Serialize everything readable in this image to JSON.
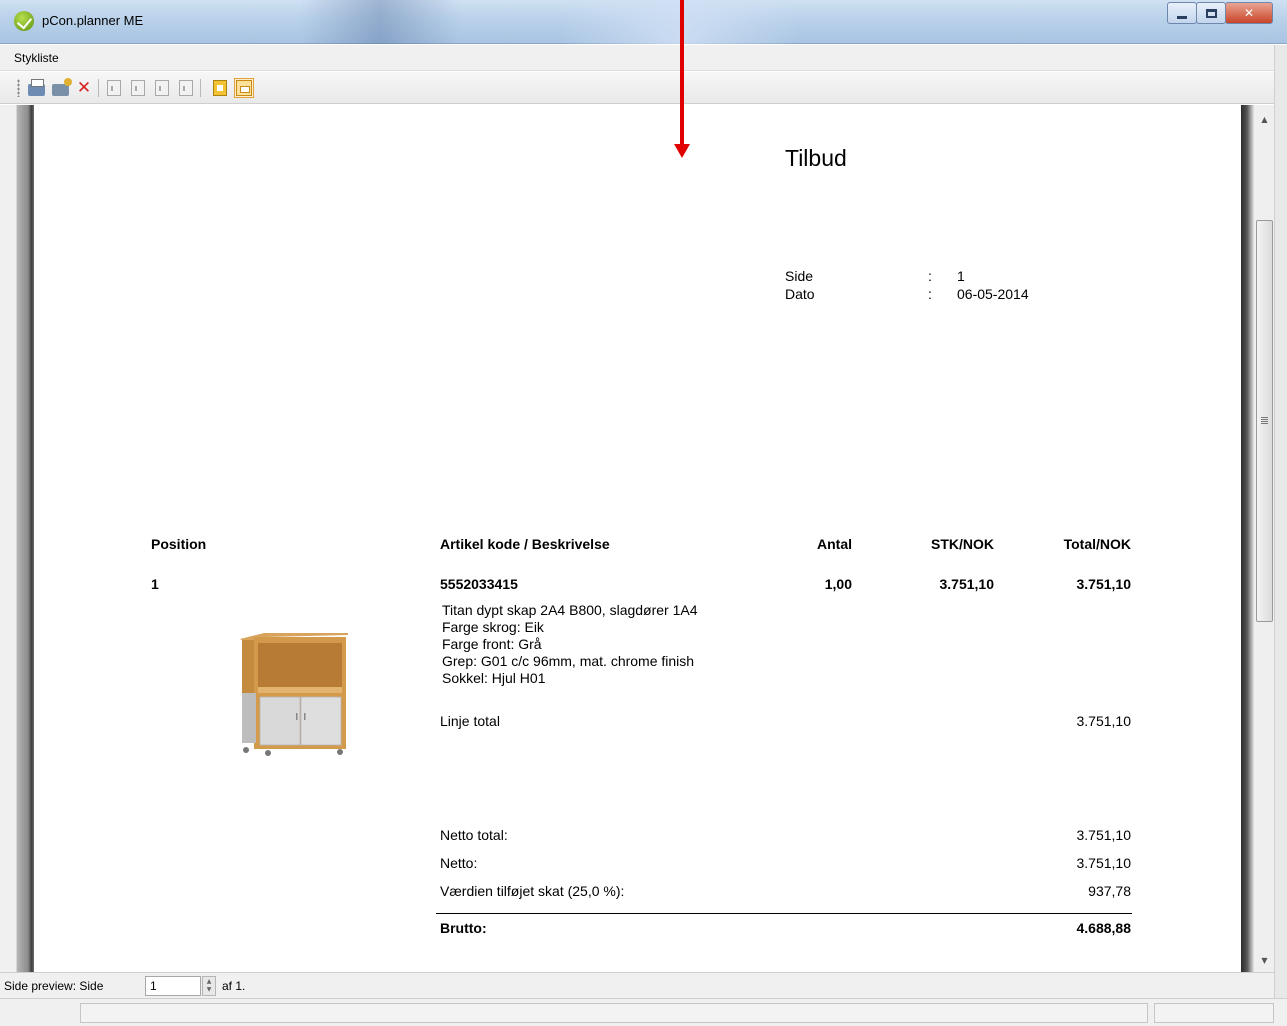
{
  "window": {
    "title": "pCon.planner ME"
  },
  "menu": {
    "items": [
      "Stykliste"
    ]
  },
  "toolbar": {
    "buttons": [
      "print-icon",
      "print-setup-icon",
      "close-icon",
      "first-page-icon",
      "previous-page-icon",
      "next-page-icon",
      "last-page-icon",
      "zoom-icon",
      "save-icon"
    ]
  },
  "document": {
    "title": "Tilbud",
    "meta": [
      {
        "label": "Side",
        "sep": ":",
        "value": "1"
      },
      {
        "label": "Dato",
        "sep": ":",
        "value": "06-05-2014"
      }
    ],
    "columns": {
      "position": "Position",
      "article": "Artikel kode / Beskrivelse",
      "qty": "Antal",
      "unit": "STK/NOK",
      "total": "Total/NOK"
    },
    "item": {
      "position": "1",
      "code": "5552033415",
      "qty": "1,00",
      "unit_price": "3.751,10",
      "total": "3.751,10",
      "description": [
        "Titan dypt skap 2A4 B800, slagdører 1A4",
        "Farge skrog: Eik",
        "Farge front: Grå",
        "Grep: G01 c/c 96mm, mat. chrome finish",
        "Sokkel: Hjul H01"
      ],
      "line_total_label": "Linje total",
      "line_total": "3.751,10"
    },
    "summary": {
      "netto_total_label": "Netto total:",
      "netto_total": "3.751,10",
      "netto_label": "Netto:",
      "netto": "3.751,10",
      "vat_label": "Værdien tilføjet skat (25,0 %):",
      "vat": "937,78",
      "brutto_label": "Brutto:",
      "brutto": "4.688,88"
    }
  },
  "pagebar": {
    "label": "Side preview:  Side",
    "page": "1",
    "of": "af 1."
  },
  "colors": {
    "annotation_arrow": "#e00000",
    "titlebar": "#b9d1ea"
  }
}
